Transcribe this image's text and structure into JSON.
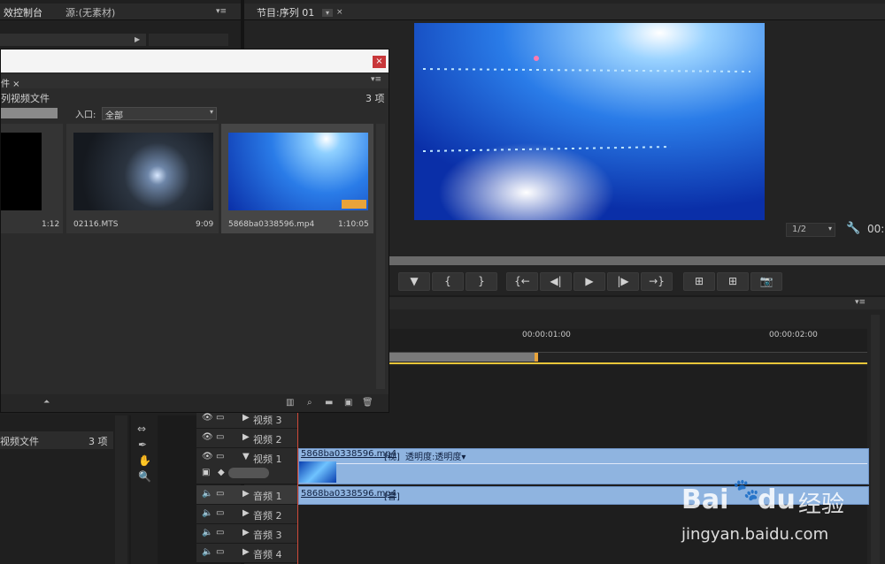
{
  "left_tabs": {
    "effect_controls": "效控制台",
    "source": "源:(无素材)"
  },
  "program_tab": "节目:序列 01",
  "program_zoom": "1/2",
  "program_timecode": "00:",
  "project_browser": {
    "title_label": "列视频文件",
    "count": "3 项",
    "entry_label": "入口:",
    "entry_value": "全部",
    "items": [
      {
        "name": "",
        "duration": "1:12"
      },
      {
        "name": "02116.MTS",
        "duration": "9:09"
      },
      {
        "name": "5868ba0338596.mp4",
        "duration": "1:10:05"
      }
    ]
  },
  "left_bottom": {
    "item_label": "视频文件",
    "count": "3 项"
  },
  "transport": [
    "▼",
    "{",
    "}",
    "{←",
    "◀|",
    "▶",
    "|▶",
    "→}",
    "⊞",
    "⊞",
    "📷"
  ],
  "timeline": {
    "ruler": [
      "00:00:01:00",
      "00:00:02:00"
    ],
    "tracks": [
      {
        "name": "视频 3",
        "type": "video"
      },
      {
        "name": "视频 2",
        "type": "video"
      },
      {
        "name": "视频 1",
        "type": "video"
      },
      {
        "name": "音频 1",
        "type": "audio"
      },
      {
        "name": "音频 2",
        "type": "audio"
      },
      {
        "name": "音频 3",
        "type": "audio"
      },
      {
        "name": "音频 4",
        "type": "audio"
      }
    ],
    "video_clip": {
      "file": "5868ba0338596.mp4",
      "tag": "[视]",
      "opacity": "透明度:透明度▾"
    },
    "audio_clip": {
      "file": "5868ba0338596.mp4",
      "tag": "[音]"
    }
  },
  "watermark": {
    "brand": "Bai",
    "brand2": "du",
    "cn": "经验",
    "url": "jingyan.baidu.com"
  },
  "colors": {
    "accent_orange": "#e8a33a",
    "clip_blue": "#8fb4e0",
    "close_red": "#c8373a"
  }
}
